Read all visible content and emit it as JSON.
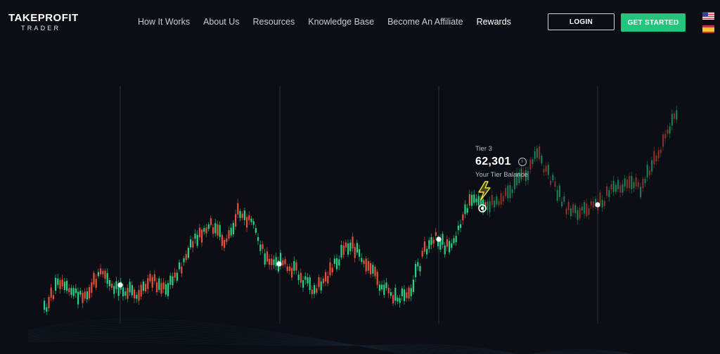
{
  "header": {
    "logo_main": "TAKEPROFIT",
    "logo_sub": "TRADER",
    "nav": [
      {
        "label": "How It Works"
      },
      {
        "label": "About Us"
      },
      {
        "label": "Resources"
      },
      {
        "label": "Knowledge Base"
      },
      {
        "label": "Become An Affiliate"
      },
      {
        "label": "Rewards"
      }
    ],
    "login_label": "LOGIN",
    "get_started_label": "GET STARTED"
  },
  "tier": {
    "label": "Tier 3",
    "value": "62,301",
    "sub": "Your Tier Balance",
    "info_glyph": "i"
  },
  "colors": {
    "background": "#0b0f15",
    "bullish": "#2ccf86",
    "bearish": "#e0523a",
    "accent": "#23c57c",
    "bolt": "#f2e63a"
  },
  "icons": {
    "tier_marker": "lightning-bolt-icon",
    "info": "info-icon",
    "flag_us": "us-flag-icon",
    "flag_es": "es-flag-icon"
  }
}
